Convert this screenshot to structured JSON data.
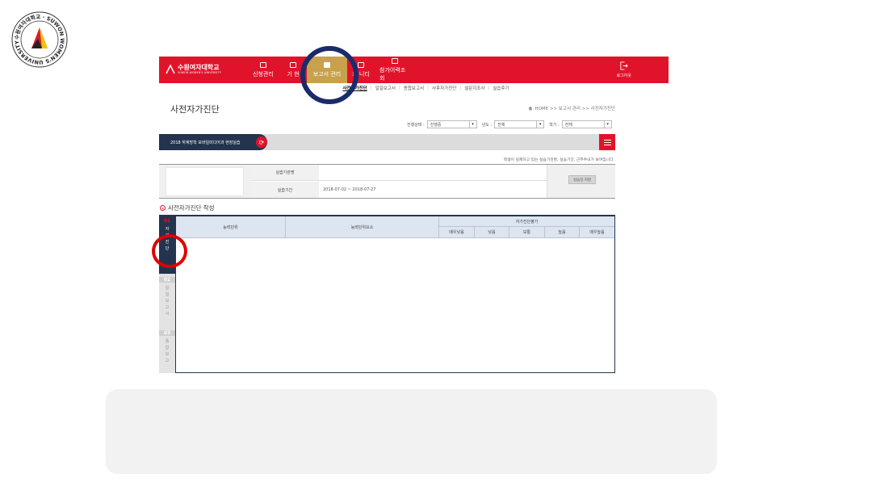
{
  "colors": {
    "accent": "#e1132a",
    "navy": "#24344f",
    "gold": "#c7a14b",
    "annotation_blue": "#1a2b6b",
    "annotation_red": "#e00000"
  },
  "seal": {
    "text": "수원여자대학교 SUWON WOMEN'S UNIVERSITY",
    "icon": "university-seal-icon"
  },
  "header": {
    "brand_kr": "수원여자대학교",
    "brand_en": "SUWON WOMEN'S UNIVERSITY",
    "menu": [
      {
        "label": "신청관리",
        "icon": "edit-icon"
      },
      {
        "label": "기 현",
        "icon": "edit-icon"
      },
      {
        "label": "보고서 관리",
        "icon": "folder-icon",
        "active": true
      },
      {
        "label": "커 니티",
        "icon": "community-icon"
      },
      {
        "label": "참가이력조회",
        "icon": "history-icon"
      }
    ],
    "logout": "로그아웃"
  },
  "subnav": [
    "사전자가진단",
    "일일보고서",
    "종합보고서",
    "사후자가진단",
    "설문지조사",
    "실습후기"
  ],
  "page": {
    "title": "사전자가진단",
    "breadcrumb": "HOME >> 보고서 관리 >> 사전자가진단"
  },
  "filters": {
    "status_label": "진행상태 :",
    "status_value": "진행중",
    "year_label": "년도 :",
    "year_value": "전체",
    "term_label": "학기 :",
    "term_value": "전체"
  },
  "course": {
    "name": "2018 하계방학 모바일미디어과 현장실습"
  },
  "notice": "학생이 실제하고 있는 실습기관명, 실습기간, 근무주내가 보여집니다.",
  "info": {
    "org_label": "실습기관명",
    "org_value": "",
    "period_label": "실습기간",
    "period_value": "2018-07-02 ~ 2018-07-27",
    "assign_button": "실습장 지정"
  },
  "section": {
    "title": "사전자가진단 작성"
  },
  "side_tabs": [
    {
      "num": "01",
      "label": "자가진단"
    },
    {
      "num": "02",
      "label": "일일보고서"
    },
    {
      "num": "03",
      "label": "종합보고"
    }
  ],
  "grid": {
    "col_unit": "능력단위",
    "col_element": "능력단위요소",
    "group": "자가진단평가",
    "ratings": [
      "매우낮음",
      "낮음",
      "보통",
      "높음",
      "매우높음"
    ]
  }
}
